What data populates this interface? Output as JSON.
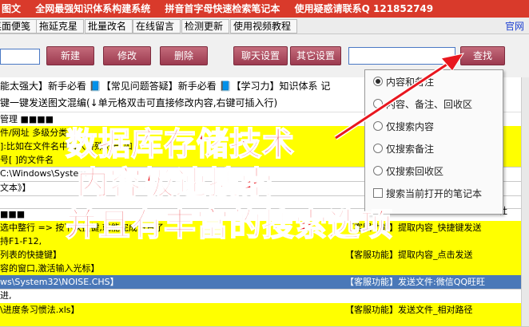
{
  "titlebar": {
    "items": [
      "图文",
      "全网最强知识体系构建系统",
      "拼音首字母快速检索笔记本",
      "使用疑惑请联系Q 121852749"
    ]
  },
  "menubar": {
    "items": [
      "桌面便笺",
      "拖延克星",
      "批量改名",
      "在线留言",
      "检测更新",
      "使用视频教程"
    ],
    "right_link": "官网"
  },
  "toolbar": {
    "buttons": [
      "新建",
      "修改",
      "删除",
      "聊天设置",
      "其它设置",
      "查找"
    ]
  },
  "links": {
    "text": "能太强大】新手必看 📘【常见问题答疑】新手必看  📘【学习力】知识体系 记"
  },
  "note_row": {
    "text": "键一键发送图文混编(↓单元格双击可直接修改内容,右键可插入行)"
  },
  "rows": [
    {
      "left": "管理 ■■■■",
      "right": "",
      "style": "white"
    },
    {
      "left": "件/网址 多级分类",
      "right": "",
      "style": "yel"
    },
    {
      "left": "]:比如在文件名中加入特殊符号,如",
      "right": "",
      "style": "yel"
    },
    {
      "left": "号[ ]的文件名",
      "right": "",
      "style": "yel"
    },
    {
      "left": "C:\\Windows\\System",
      "right": "",
      "style": "white"
    },
    {
      "left": "文本》】",
      "right": "",
      "style": "white"
    },
    {
      "left": "",
      "right": "",
      "style": "white"
    },
    {
      "left": "■■■",
      "right": "",
      "style": "white"
    },
    {
      "left": "选中整行 => 按下快捷键,就能完成设置了,",
      "right": "【客服功能】提取内容_快捷键发送",
      "style": "yel"
    },
    {
      "left": "持F1-F12,",
      "right": "",
      "style": "yel"
    },
    {
      "left": "列表的快捷键】",
      "right": "【客服功能】提取内容_点击发送",
      "style": "yel"
    },
    {
      "left": "容的窗口,激活输入光标】",
      "right": "",
      "style": "yel"
    },
    {
      "left": "ws\\System32\\NOISE.CHS】",
      "right": "【客服功能】发送文件:微信QQ旺旺",
      "style": "blue"
    },
    {
      "left": "进,",
      "right": "",
      "style": "white"
    },
    {
      "left": "\\进度条习惯法.xls】",
      "right": "【客服功能】发送文件_相对路径",
      "style": "yel"
    },
    {
      "left": "",
      "right": "",
      "style": "yel"
    }
  ],
  "extra_right": [
    "社"
  ],
  "dropdown": {
    "options": [
      {
        "label": "内容和备注",
        "type": "radio",
        "checked": true
      },
      {
        "label": "内容、备注、回收区",
        "type": "radio",
        "checked": false
      },
      {
        "label": "仅搜索内容",
        "type": "radio",
        "checked": false
      },
      {
        "label": "仅搜索备注",
        "type": "radio",
        "checked": false
      },
      {
        "label": "仅搜索回收区",
        "type": "radio",
        "checked": false
      },
      {
        "label": "搜索当前打开的笔记本",
        "type": "checkbox",
        "checked": false
      }
    ]
  },
  "overlay": {
    "line1": "数据库存储技术",
    "line2": "内容极速搜索",
    "line3": "并且有丰富的搜索选项"
  },
  "colors": {
    "title_bg": "#d93a2b",
    "button": "#9c3a4f",
    "highlight_yellow": "#ffff00",
    "selected_row": "#4a78b8",
    "overlay_text": "#e8171f"
  }
}
